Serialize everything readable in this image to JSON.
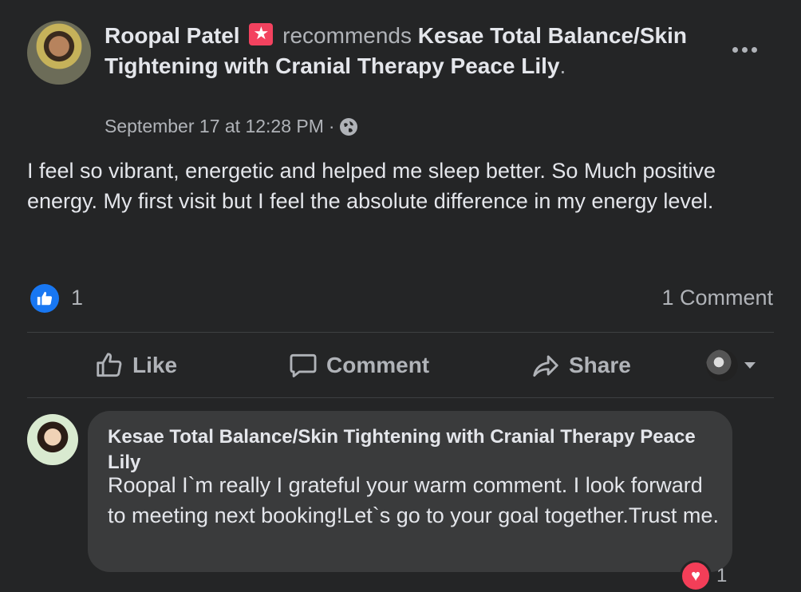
{
  "post": {
    "author": "Roopal Patel",
    "action": "recommends",
    "page_name": "Kesae Total Balance/Skin Tightening with Cranial Therapy Peace Lily",
    "period": ".",
    "timestamp": "September 17 at 12:28 PM",
    "separator": "·",
    "privacy_icon": "globe-icon",
    "recommend_icon": "recommend-star-icon",
    "body": "I feel so vibrant, energetic and helped me sleep better. So Much positive energy. My first visit but I feel the absolute difference in my energy level."
  },
  "stats": {
    "like_count": "1",
    "comment_count": "1 Comment"
  },
  "actions": {
    "like": "Like",
    "comment": "Comment",
    "share": "Share"
  },
  "comment": {
    "author": "Kesae Total Balance/Skin Tightening with Cranial Therapy Peace Lily",
    "text": "Roopal I`m really I grateful your warm comment. I look forward to meeting next booking!Let`s go to your goal together.Trust me.",
    "reaction_count": "1"
  },
  "colors": {
    "background": "#242526",
    "bubble": "#3a3b3c",
    "like_blue": "#1877f2",
    "recommend_red": "#f3425f",
    "heart_red": "#f33e58"
  }
}
